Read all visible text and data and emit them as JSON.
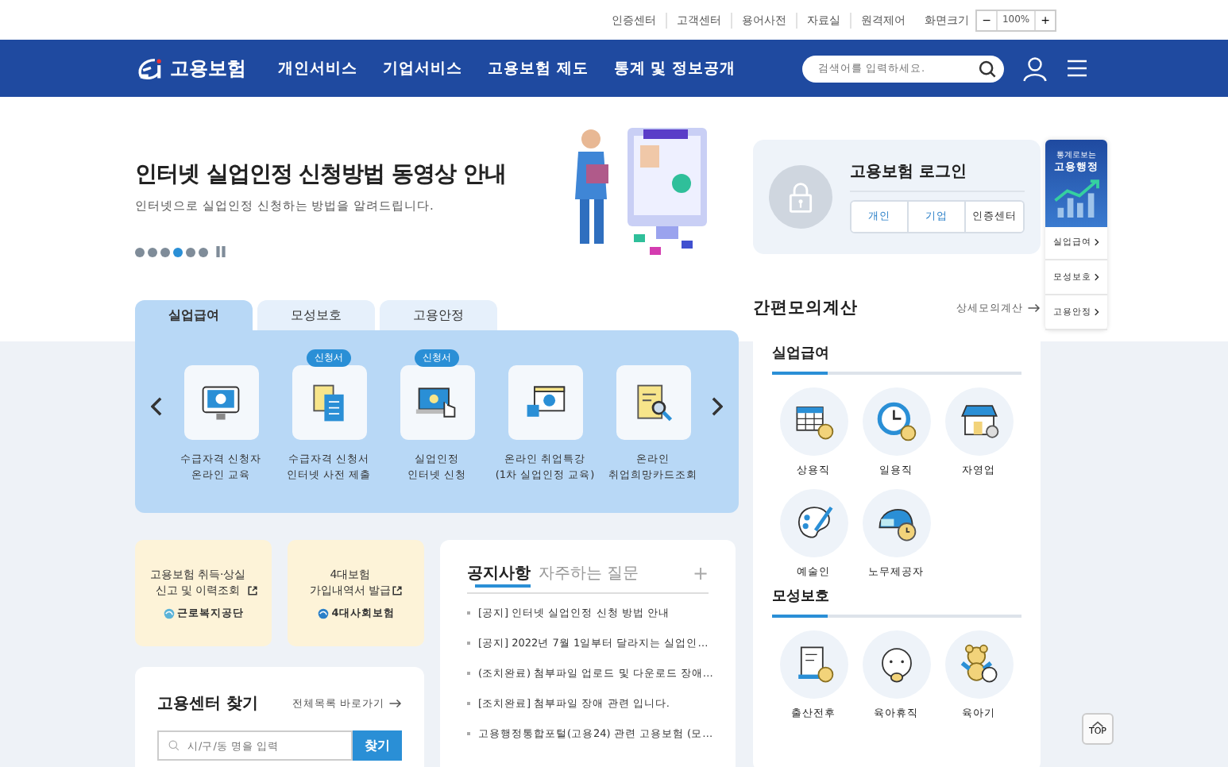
{
  "utility_bar": {
    "links": [
      "인증센터",
      "고객센터",
      "용어사전",
      "자료실",
      "원격제어"
    ],
    "zoom_label": "화면크기",
    "zoom_minus": "−",
    "zoom_value": "100%",
    "zoom_plus": "+"
  },
  "nav": {
    "logo": "고용보험",
    "menu": [
      "개인서비스",
      "기업서비스",
      "고용보험 제도",
      "통계 및 정보공개"
    ],
    "search": {
      "placeholder": "검색어를 입력하세요."
    }
  },
  "banner": {
    "title": "인터넷 실업인정 신청방법 동영상 안내",
    "subtitle": "인터넷으로 실업인정 신청하는 방법을 알려드립니다.",
    "slides": [
      {
        "selected": false
      },
      {
        "selected": false
      },
      {
        "selected": false
      },
      {
        "selected": true
      },
      {
        "selected": false
      },
      {
        "selected": false
      }
    ]
  },
  "service_tabs": [
    {
      "label": "실업급여",
      "selected": true
    },
    {
      "label": "모성보호",
      "selected": false
    },
    {
      "label": "고용안정",
      "selected": false
    }
  ],
  "services": [
    {
      "lines": [
        "수급자격 신청자",
        "온라인 교육"
      ]
    },
    {
      "badge": "신청서",
      "lines": [
        "수급자격 신청서",
        "인터넷 사전 제출"
      ]
    },
    {
      "badge": "신청서",
      "lines": [
        "실업인정",
        "인터넷 신청"
      ]
    },
    {
      "lines": [
        "온라인 취업특강",
        "(1차 실업인정 교육)"
      ]
    },
    {
      "lines": [
        "온라인",
        "취업희망카드조회"
      ]
    }
  ],
  "quick_links": [
    {
      "lines": [
        "고용보험 취득·상실",
        "신고 및 이력조회"
      ],
      "org": "근로복지공단"
    },
    {
      "lines": [
        "4대보험",
        "가입내역서 발급"
      ],
      "org": "4대사회보험"
    }
  ],
  "notices": {
    "tabs": [
      {
        "label": "공지사항",
        "selected": true
      },
      {
        "label": "자주하는 질문",
        "selected": false
      }
    ],
    "more": "+",
    "items": [
      "[공지] 인터넷 실업인정 신청 방법 안내",
      "[공지] 2022년 7월 1일부터 달라지는 실업인…",
      "(조치완료) 첨부파일 업로드 및 다운로드 장애…",
      "[조치완료] 첨부파일 장애 관련 입니다.",
      "고용행정통합포털(고용24) 관련 고용보험 (모…"
    ]
  },
  "center_search": {
    "title": "고용센터 찾기",
    "link": "전체목록 바로가기",
    "placeholder": "시/구/동 명을 입력",
    "button": "찾기"
  },
  "login": {
    "title": "고용보험 로그인",
    "buttons": [
      "개인",
      "기업",
      "인증센터"
    ]
  },
  "calculator": {
    "title": "간편모의계산",
    "link": "상세모의계산",
    "sections": [
      {
        "title": "실업급여",
        "items": [
          "상용직",
          "일용직",
          "자영업",
          "예술인",
          "노무제공자"
        ]
      },
      {
        "title": "모성보호",
        "items": [
          "출산전후",
          "육아휴직",
          "육아기"
        ]
      }
    ]
  },
  "stats_widget": {
    "caption": "통계로보는",
    "title": "고용행정",
    "links": [
      "실업급여",
      "모성보호",
      "고용안정"
    ]
  },
  "top_button": "TOP"
}
